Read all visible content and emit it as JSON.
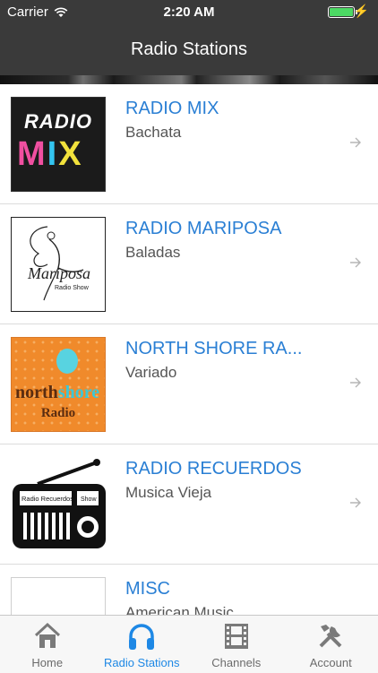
{
  "status": {
    "carrier": "Carrier",
    "time": "2:20 AM"
  },
  "nav": {
    "title": "Radio Stations"
  },
  "stations": [
    {
      "name": "RADIO MIX",
      "genre": "Bachata",
      "logo_text": [
        "RADIO",
        "MIX"
      ]
    },
    {
      "name": "RADIO MARIPOSA",
      "genre": "Baladas",
      "logo_text": [
        "Mariposa",
        "Radio Show"
      ]
    },
    {
      "name": "NORTH SHORE RA...",
      "genre": "Variado",
      "logo_text": [
        "north",
        "shore",
        "Radio"
      ]
    },
    {
      "name": "RADIO RECUERDOS",
      "genre": "Musica Vieja",
      "logo_text": [
        "Radio Recuerdos",
        "Show"
      ]
    },
    {
      "name": "MISC",
      "genre": "American Music"
    }
  ],
  "tabs": [
    {
      "label": "Home",
      "icon": "home-icon",
      "active": false
    },
    {
      "label": "Radio Stations",
      "icon": "headphones-icon",
      "active": true
    },
    {
      "label": "Channels",
      "icon": "film-icon",
      "active": false
    },
    {
      "label": "Account",
      "icon": "tools-icon",
      "active": false
    }
  ],
  "colors": {
    "accent": "#2a7fd4",
    "tab_active": "#1e88e5",
    "battery": "#4cd964",
    "bar": "#3a3a3a"
  }
}
